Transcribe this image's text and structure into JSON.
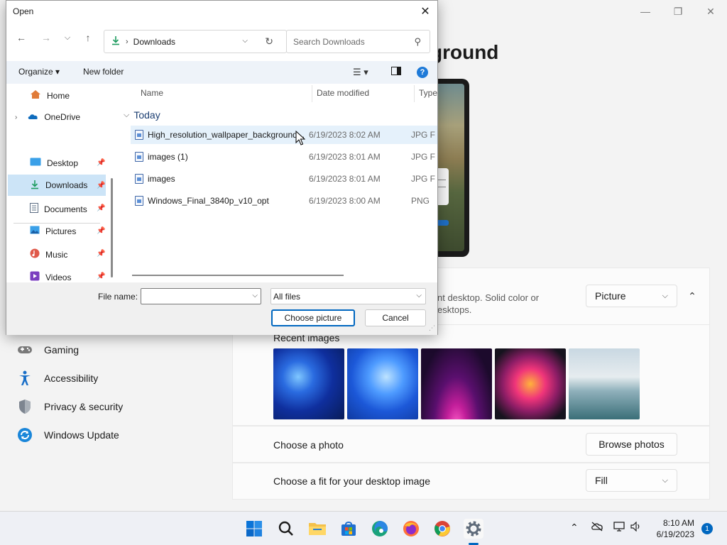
{
  "settings": {
    "page_title_partial": "ground",
    "background_desc_line1": "nt desktop. Solid color or",
    "background_desc_line2": "esktops.",
    "background_type": "Picture",
    "recent_images_label": "Recent images",
    "choose_photo_label": "Choose a photo",
    "browse_photos_button": "Browse photos",
    "choose_fit_label": "Choose a fit for your desktop image",
    "fit_value": "Fill",
    "nav": [
      {
        "label": "Gaming",
        "icon": "gamepad-icon"
      },
      {
        "label": "Accessibility",
        "icon": "accessibility-icon"
      },
      {
        "label": "Privacy & security",
        "icon": "shield-icon"
      },
      {
        "label": "Windows Update",
        "icon": "update-icon"
      }
    ],
    "window_controls": {
      "minimize": "—",
      "maximize": "❐",
      "close": "✕"
    }
  },
  "dialog": {
    "title": "Open",
    "close": "✕",
    "address": "Downloads",
    "search_placeholder": "Search Downloads",
    "organize": "Organize ▾",
    "new_folder": "New folder",
    "help": "?",
    "nav_pane": [
      {
        "label": "Home",
        "icon": "home-icon"
      },
      {
        "label": "OneDrive",
        "icon": "onedrive-icon"
      },
      {
        "label": "Desktop",
        "icon": "desktop-icon"
      },
      {
        "label": "Downloads",
        "icon": "downloads-icon",
        "selected": true
      },
      {
        "label": "Documents",
        "icon": "documents-icon"
      },
      {
        "label": "Pictures",
        "icon": "pictures-icon"
      },
      {
        "label": "Music",
        "icon": "music-icon"
      },
      {
        "label": "Videos",
        "icon": "videos-icon"
      }
    ],
    "columns": {
      "name": "Name",
      "date_modified": "Date modified",
      "type": "Type"
    },
    "group_label": "Today",
    "files": [
      {
        "name": "High_resolution_wallpaper_background...",
        "date": "6/19/2023 8:02 AM",
        "type": "JPG F"
      },
      {
        "name": "images (1)",
        "date": "6/19/2023 8:01 AM",
        "type": "JPG F"
      },
      {
        "name": "images",
        "date": "6/19/2023 8:01 AM",
        "type": "JPG F"
      },
      {
        "name": "Windows_Final_3840p_v10_opt",
        "date": "6/19/2023 8:00 AM",
        "type": "PNG"
      }
    ],
    "file_name_label": "File name:",
    "file_name_value": "",
    "file_type": "All files",
    "choose_button": "Choose picture",
    "cancel_button": "Cancel"
  },
  "taskbar": {
    "time": "8:10 AM",
    "date": "6/19/2023",
    "notifications": "1",
    "apps": [
      "start-icon",
      "search-icon",
      "file-explorer-icon",
      "store-icon",
      "edge-icon",
      "firefox-icon",
      "chrome-icon",
      "settings-icon"
    ]
  },
  "colors": {
    "accent": "#0067c0",
    "selection": "#cce4f7",
    "hover": "#e5f1fb"
  }
}
